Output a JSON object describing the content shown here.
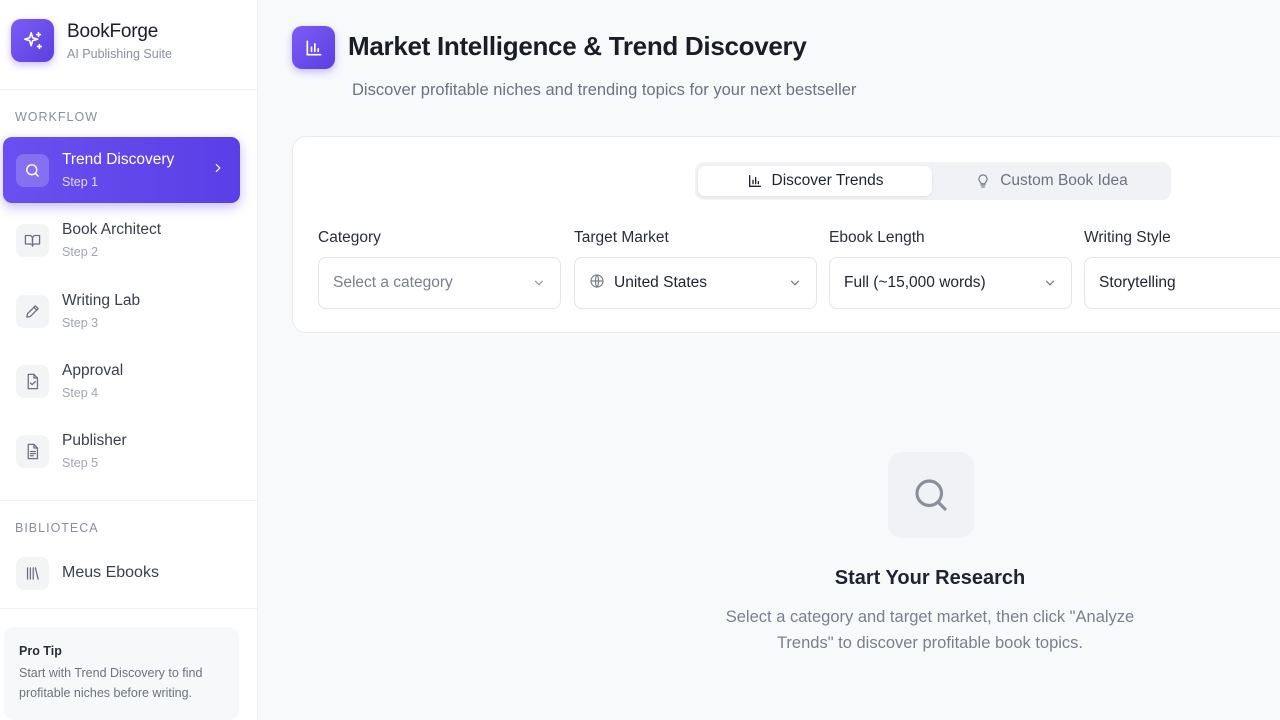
{
  "brand": {
    "name": "BookForge",
    "subtitle": "AI Publishing Suite"
  },
  "sidebar": {
    "workflow_label": "WORKFLOW",
    "items": [
      {
        "title": "Trend Discovery",
        "step": "Step 1",
        "icon": "search-icon",
        "active": true
      },
      {
        "title": "Book Architect",
        "step": "Step 2",
        "icon": "book-open-icon",
        "active": false
      },
      {
        "title": "Writing Lab",
        "step": "Step 3",
        "icon": "pencil-icon",
        "active": false
      },
      {
        "title": "Approval",
        "step": "Step 4",
        "icon": "file-check-icon",
        "active": false
      },
      {
        "title": "Publisher",
        "step": "Step 5",
        "icon": "file-text-icon",
        "active": false
      }
    ],
    "library_label": "BIBLIOTECA",
    "library_item": {
      "title": "Meus Ebooks",
      "icon": "library-icon"
    },
    "pro_tip": {
      "title": "Pro Tip",
      "text": "Start with Trend Discovery to find profitable niches before writing."
    }
  },
  "header": {
    "icon": "bar-chart-icon",
    "title": "Market Intelligence & Trend Discovery",
    "subtitle": "Discover profitable niches and trending topics for your next bestseller"
  },
  "tabs": [
    {
      "label": "Discover Trends",
      "icon": "bar-chart-icon",
      "active": true
    },
    {
      "label": "Custom Book Idea",
      "icon": "lightbulb-icon",
      "active": false
    }
  ],
  "fields": {
    "category": {
      "label": "Category",
      "value": "",
      "placeholder": "Select a category"
    },
    "target_market": {
      "label": "Target Market",
      "value": "United States",
      "icon": "globe-icon"
    },
    "ebook_length": {
      "label": "Ebook Length",
      "value": "Full (~15,000 words)"
    },
    "writing_style": {
      "label": "Writing Style",
      "value": "Storytelling"
    }
  },
  "empty_state": {
    "icon": "search-icon",
    "title": "Start Your Research",
    "text": "Select a category and target market, then click \"Analyze Trends\" to discover profitable book topics."
  },
  "colors": {
    "accent": "#5b3fe6",
    "accent_light": "#7c5cf5"
  }
}
